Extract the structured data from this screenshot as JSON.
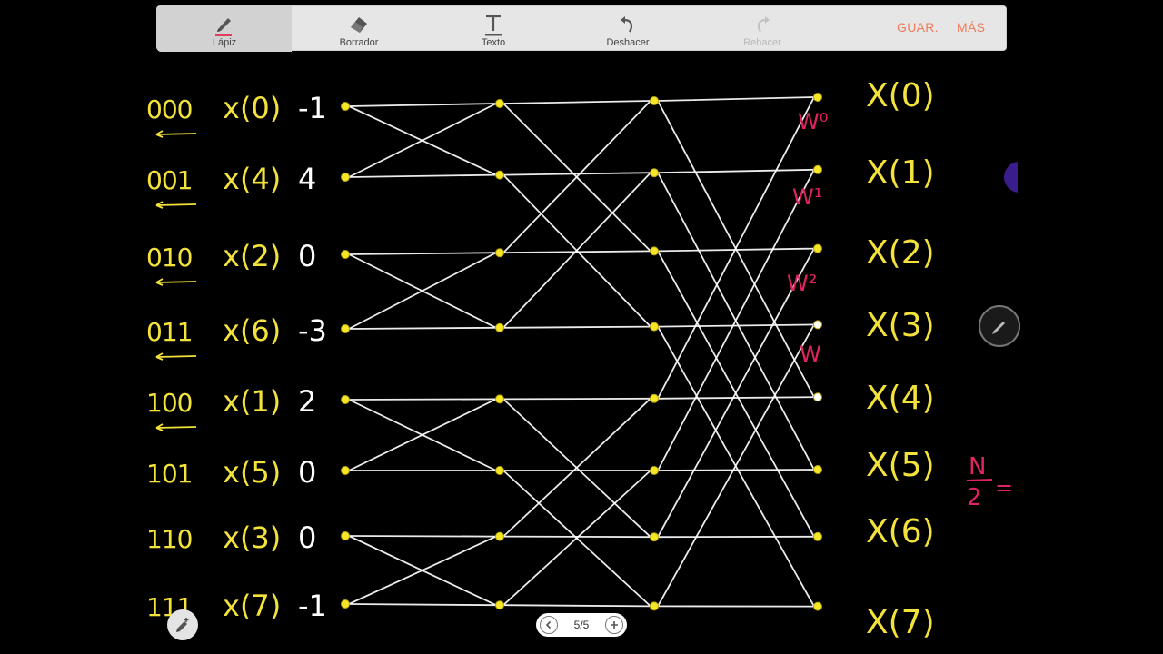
{
  "toolbar": {
    "tools": [
      {
        "label": "Lápiz",
        "icon": "pencil-icon",
        "active": true
      },
      {
        "label": "Borrador",
        "icon": "eraser-icon"
      },
      {
        "label": "Texto",
        "icon": "text-icon"
      },
      {
        "label": "Deshacer",
        "icon": "undo-icon"
      },
      {
        "label": "Rehacer",
        "icon": "redo-icon",
        "disabled": true
      }
    ],
    "save_label": "GUAR.",
    "more_label": "MÁS",
    "accent": "#ee7b5a",
    "pencil_accent": "#e53960"
  },
  "pager": {
    "text": "5/5"
  },
  "colors": {
    "ink_yellow": "#f3e23a",
    "ink_white": "#ffffff",
    "ink_pink": "#e0245e",
    "node_yellow": "#f5e629"
  },
  "sketch": {
    "bit_labels": [
      "000",
      "001",
      "010",
      "011",
      "100",
      "101",
      "110",
      "111"
    ],
    "inputs": [
      "x(0)",
      "x(4)",
      "x(2)",
      "x(6)",
      "x(1)",
      "x(5)",
      "x(3)",
      "x(7)"
    ],
    "input_values": [
      "-1",
      "4",
      "0",
      "-3",
      "2",
      "0",
      "0",
      "-1"
    ],
    "outputs": [
      "X(0)",
      "X(1)",
      "X(2)",
      "X(3)",
      "X(4)",
      "X(5)",
      "X(6)",
      "X(7)"
    ],
    "twiddles": [
      "W⁰",
      "W¹",
      "W²",
      "W"
    ],
    "note_num": "N",
    "note_den": "2",
    "note_rest": "=",
    "stages": 3
  }
}
